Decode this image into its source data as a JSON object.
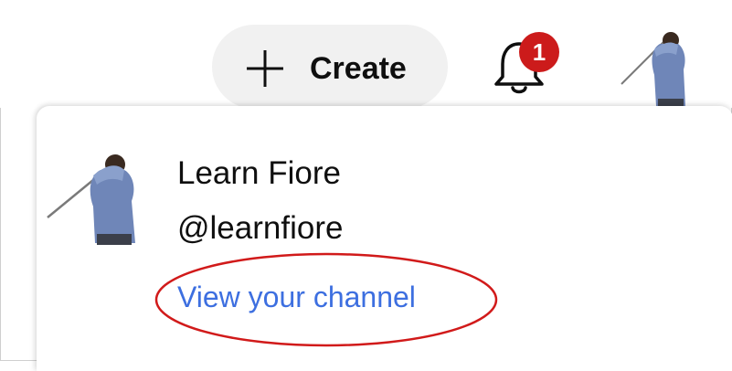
{
  "header": {
    "create_label": "Create",
    "notification_count": "1",
    "icons": {
      "create": "plus-icon",
      "notifications": "bell-icon",
      "account": "avatar"
    }
  },
  "account_menu": {
    "name": "Learn Fiore",
    "handle": "@learnfiore",
    "view_channel_label": "View your channel"
  },
  "colors": {
    "badge": "#cc1b1b",
    "link": "#3d6fe0",
    "annotation": "#d11a1a",
    "button_bg": "#f1f1f1"
  }
}
